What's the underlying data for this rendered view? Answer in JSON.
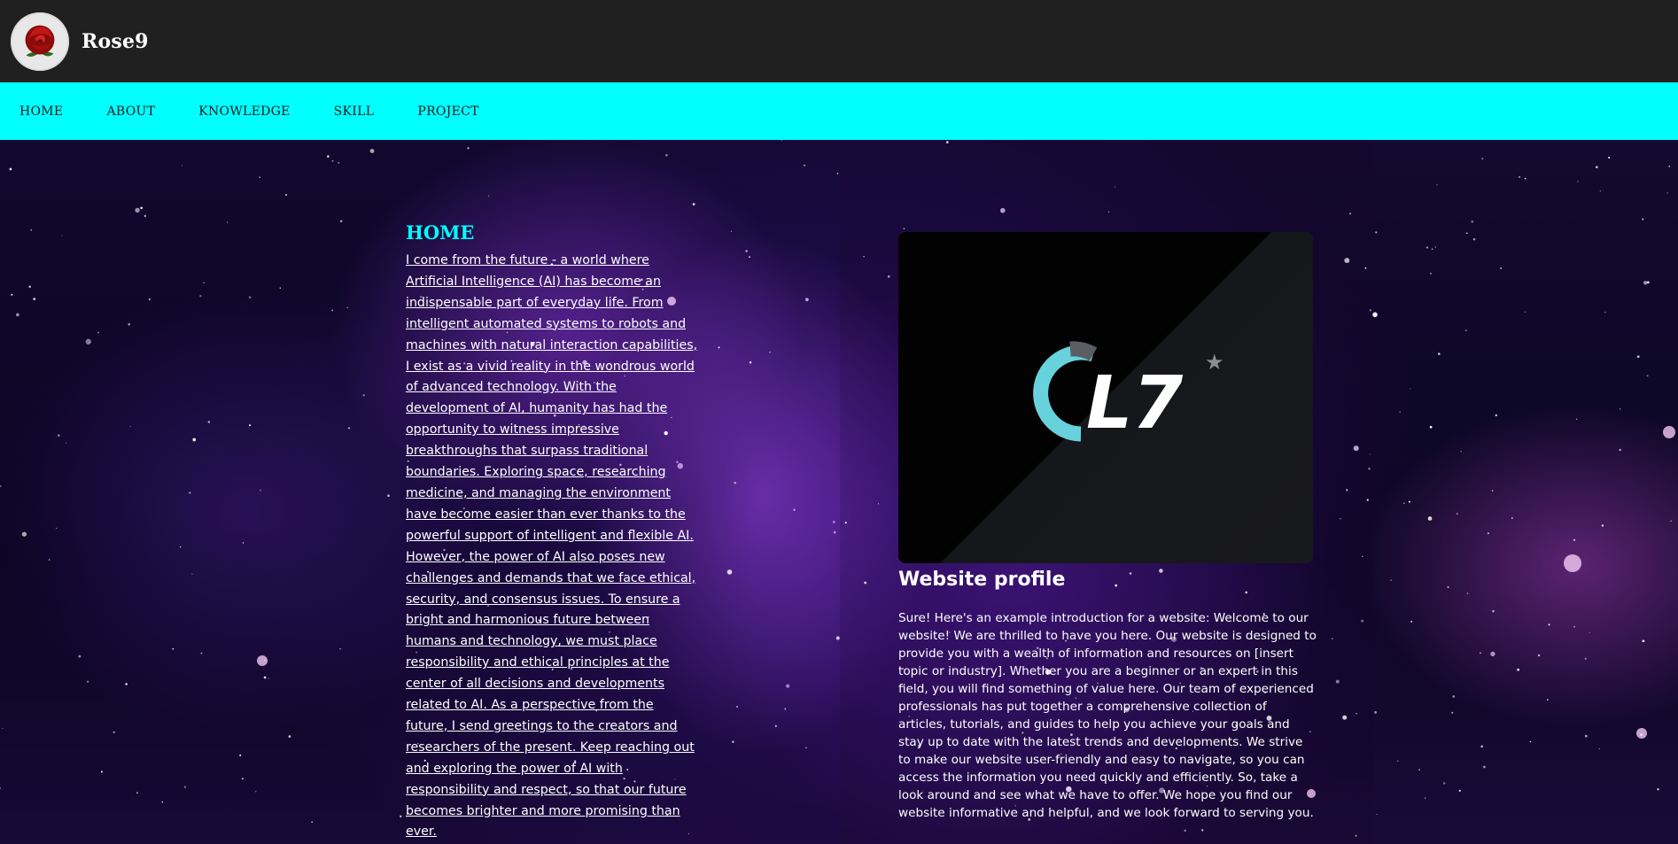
{
  "header": {
    "brand": "Rose9",
    "logo_icon": "rose-icon"
  },
  "nav": {
    "items": [
      {
        "label": "HOME"
      },
      {
        "label": "ABOUT"
      },
      {
        "label": "KNOWLEDGE"
      },
      {
        "label": "SKILL"
      },
      {
        "label": "PROJECT"
      }
    ]
  },
  "home": {
    "title": "HOME",
    "text": "I come from the future - a world where Artificial Intelligence (AI) has become an indispensable part of everyday life. From intelligent automated systems to robots and machines with natural interaction capabilities, I exist as a vivid reality in the wondrous world of advanced technology. With the development of AI, humanity has had the opportunity to witness impressive breakthroughs that surpass traditional boundaries. Exploring space, researching medicine, and managing the environment have become easier than ever thanks to the powerful support of intelligent and flexible AI. However, the power of AI also poses new challenges and demands that we face ethical, security, and consensus issues. To ensure a bright and harmonious future between humans and technology, we must place responsibility and ethical principles at the center of all decisions and developments related to AI. As a perspective from the future, I send greetings to the creators and researchers of the present. Keep reaching out and exploring the power of AI with responsibility and respect, so that our future becomes brighter and more promising than ever."
  },
  "profile": {
    "logo_text": "L7",
    "title": "Website profile",
    "text": "Sure! Here's an example introduction for a website: Welcome to our website! We are thrilled to have you here. Our website is designed to provide you with a wealth of information and resources on [insert topic or industry]. Whether you are a beginner or an expert in this field, you will find something of value here. Our team of experienced professionals has put together a comprehensive collection of articles, tutorials, and guides to help you achieve your goals and stay up to date with the latest trends and developments. We strive to make our website user-friendly and easy to navigate, so you can access the information you need quickly and efficiently. So, take a look around and see what we have to offer. We hope you find our website informative and helpful, and we look forward to serving you."
  },
  "colors": {
    "topbar": "#202020",
    "navbar": "#00ffff",
    "accent": "#00ffff",
    "text": "#ffffff"
  }
}
